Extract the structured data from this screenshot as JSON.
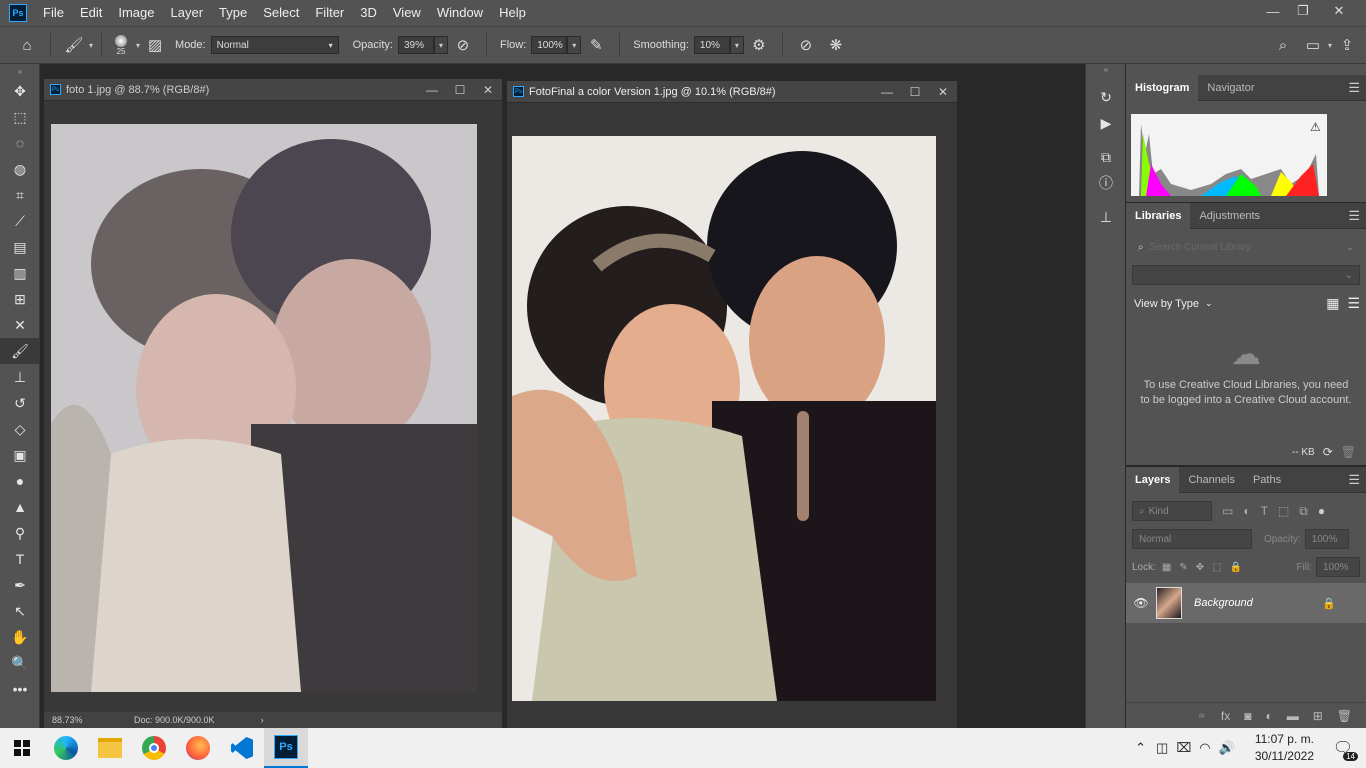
{
  "menubar": {
    "logo": "Ps",
    "items": [
      "File",
      "Edit",
      "Image",
      "Layer",
      "Type",
      "Select",
      "Filter",
      "3D",
      "View",
      "Window",
      "Help"
    ],
    "min_label": "—",
    "max_label": "❐",
    "close_label": "✕"
  },
  "options": {
    "brush_size": "25",
    "mode_label": "Mode:",
    "mode_value": "Normal",
    "opacity_label": "Opacity:",
    "opacity_value": "39%",
    "flow_label": "Flow:",
    "flow_value": "100%",
    "smoothing_label": "Smoothing:",
    "smoothing_value": "10%"
  },
  "documents": [
    {
      "title": "foto 1.jpg @ 88.7% (RGB/8#)",
      "zoom": "88.73%",
      "doc_info": "Doc: 900.0K/900.0K"
    },
    {
      "title": "FotoFinal a color Version 1.jpg @ 10.1% (RGB/8#)"
    }
  ],
  "panels": {
    "histogram": {
      "tabs": [
        "Histogram",
        "Navigator"
      ]
    },
    "libraries": {
      "tabs": [
        "Libraries",
        "Adjustments"
      ],
      "search_placeholder": "Search Current Library",
      "view_by": "View by Type",
      "message": "To use Creative Cloud Libraries, you need to be logged into a Creative Cloud account.",
      "size_label": "-- KB"
    },
    "layers": {
      "tabs": [
        "Layers",
        "Channels",
        "Paths"
      ],
      "kind_label": "Kind",
      "blend_mode": "Normal",
      "opacity_label": "Opacity:",
      "opacity_value": "100%",
      "lock_label": "Lock:",
      "fill_label": "Fill:",
      "fill_value": "100%",
      "layer_name": "Background"
    }
  },
  "taskbar": {
    "time": "11:07 p. m.",
    "date": "30/11/2022",
    "notif_count": "14"
  }
}
